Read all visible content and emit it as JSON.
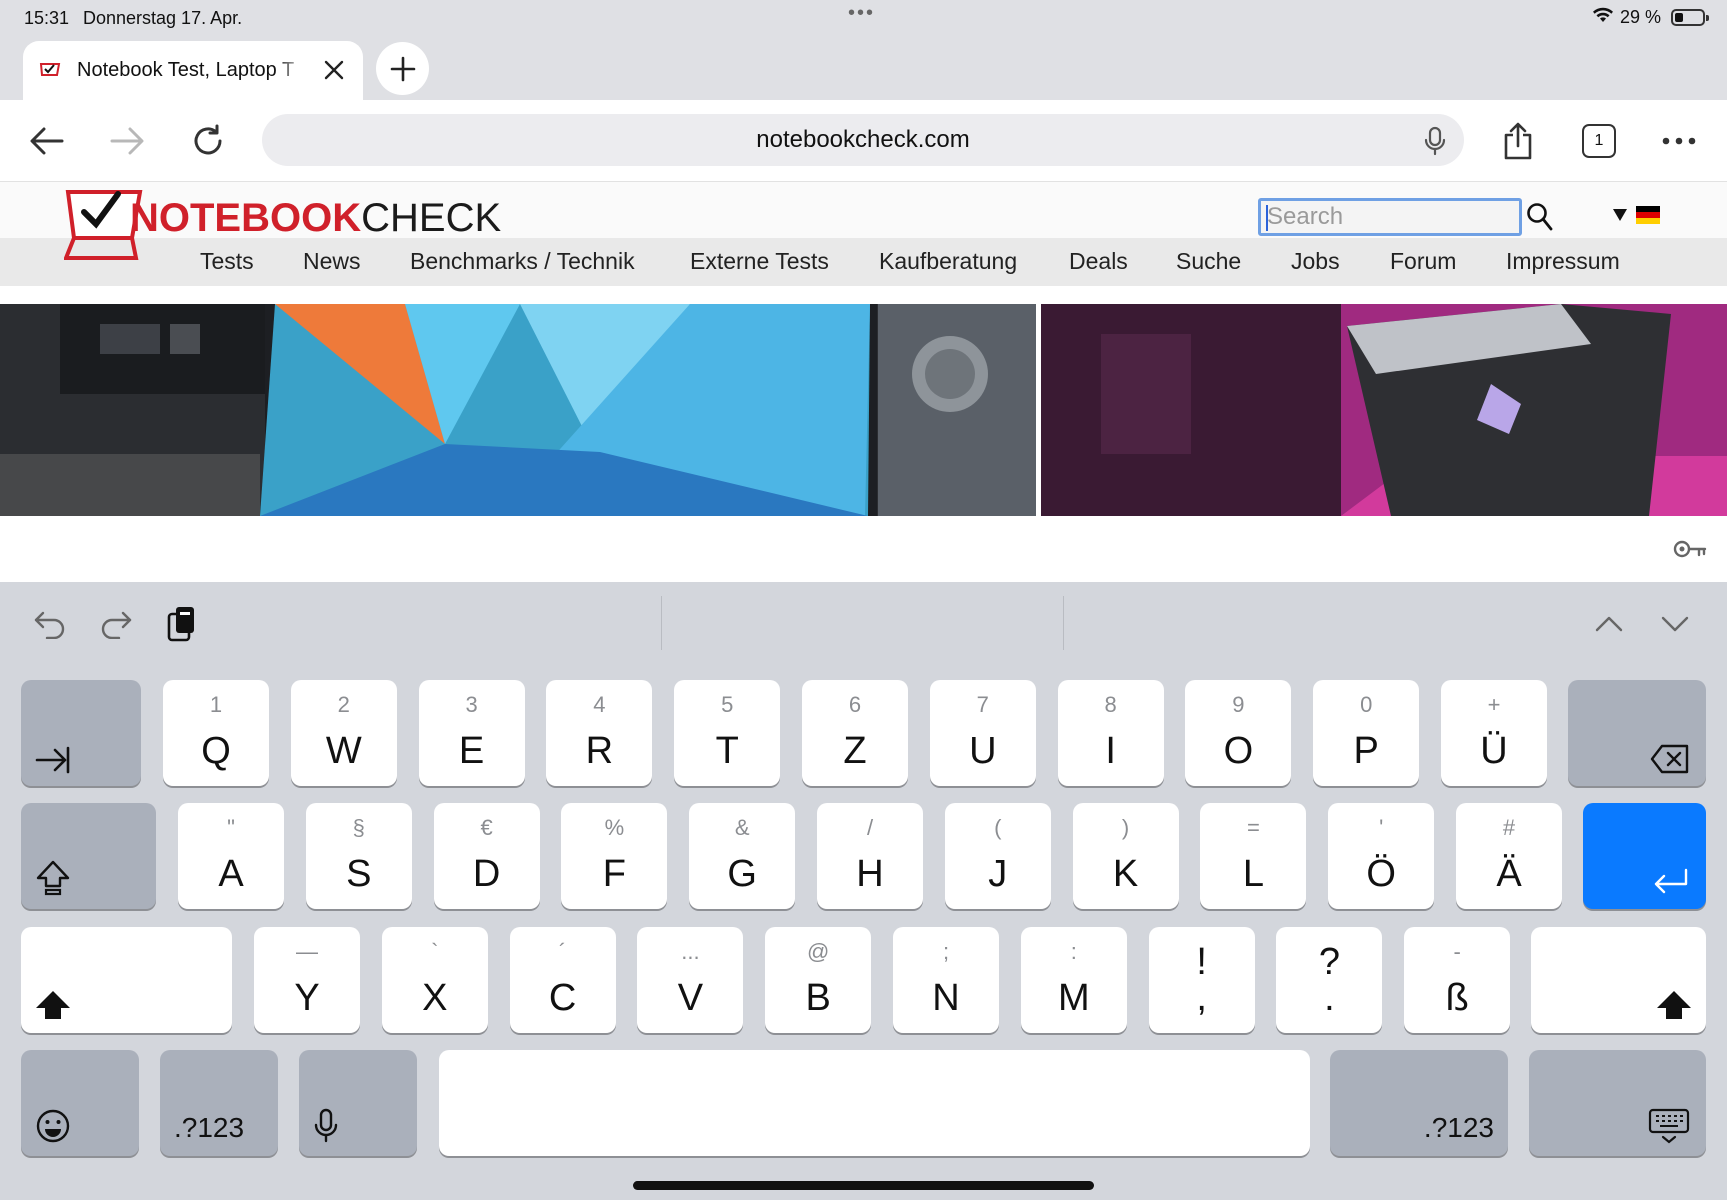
{
  "status_bar": {
    "time": "15:31",
    "date": "Donnerstag 17. Apr.",
    "dots": "•••",
    "battery_text": "29 %",
    "battery_level": 0.29
  },
  "tabs": [
    {
      "title": "Notebook Test, Laptop T"
    }
  ],
  "toolbar": {
    "url": "notebookcheck.com",
    "tab_count": "1"
  },
  "site": {
    "logo_part1": "NOTEBOOK",
    "logo_part2": "CHECK",
    "search_placeholder": "Search",
    "nav": [
      "Tests",
      "News",
      "Benchmarks / Technik",
      "Externe Tests",
      "Kaufberatung",
      "Deals",
      "Suche",
      "Jobs",
      "Forum",
      "Impressum"
    ]
  },
  "keyboard": {
    "row1": [
      {
        "hint": "1",
        "key": "Q"
      },
      {
        "hint": "2",
        "key": "W"
      },
      {
        "hint": "3",
        "key": "E"
      },
      {
        "hint": "4",
        "key": "R"
      },
      {
        "hint": "5",
        "key": "T"
      },
      {
        "hint": "6",
        "key": "Z"
      },
      {
        "hint": "7",
        "key": "U"
      },
      {
        "hint": "8",
        "key": "I"
      },
      {
        "hint": "9",
        "key": "O"
      },
      {
        "hint": "0",
        "key": "P"
      },
      {
        "hint": "+",
        "key": "Ü"
      }
    ],
    "row2": [
      {
        "hint": "\"",
        "key": "A"
      },
      {
        "hint": "§",
        "key": "S"
      },
      {
        "hint": "€",
        "key": "D"
      },
      {
        "hint": "%",
        "key": "F"
      },
      {
        "hint": "&",
        "key": "G"
      },
      {
        "hint": "/",
        "key": "H"
      },
      {
        "hint": "(",
        "key": "J"
      },
      {
        "hint": ")",
        "key": "K"
      },
      {
        "hint": "=",
        "key": "L"
      },
      {
        "hint": "'",
        "key": "Ö"
      },
      {
        "hint": "#",
        "key": "Ä"
      }
    ],
    "row3": [
      {
        "hint": "—",
        "key": "Y"
      },
      {
        "hint": "`",
        "key": "X"
      },
      {
        "hint": "´",
        "key": "C"
      },
      {
        "hint": "...",
        "key": "V"
      },
      {
        "hint": "@",
        "key": "B"
      },
      {
        "hint": ";",
        "key": "N"
      },
      {
        "hint": ":",
        "key": "M"
      }
    ],
    "row3_punct": [
      {
        "top": "!",
        "bottom": ","
      },
      {
        "top": "?",
        "bottom": "."
      }
    ],
    "row3_eszett": {
      "hint": "-",
      "key": "ß"
    },
    "numbers_label": ".?123"
  }
}
